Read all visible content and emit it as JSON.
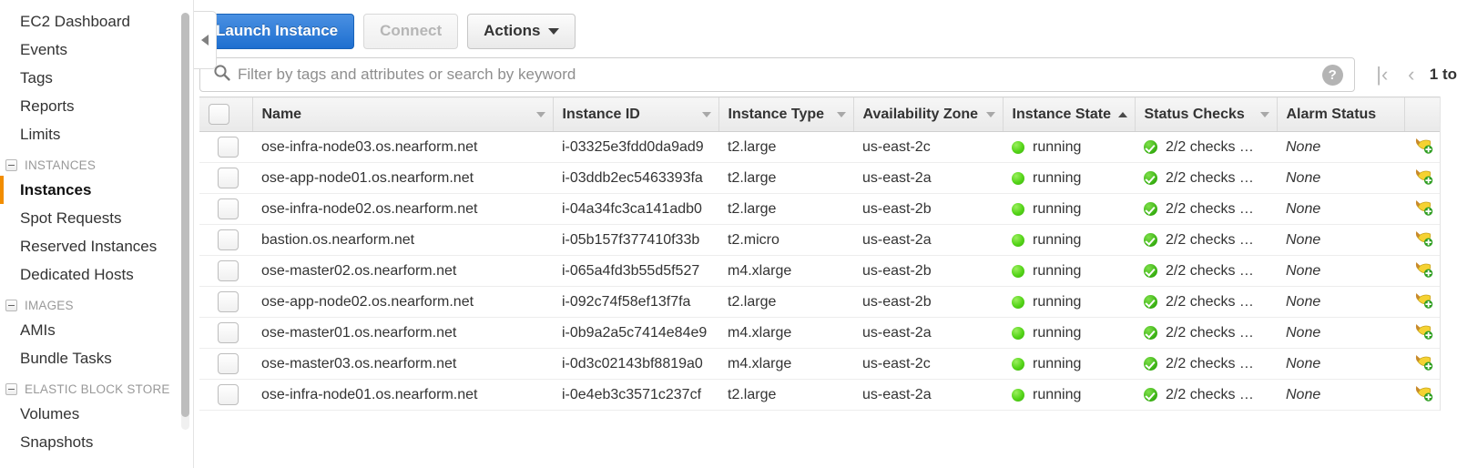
{
  "sidebar": {
    "top_links": [
      {
        "label": "EC2 Dashboard"
      },
      {
        "label": "Events"
      },
      {
        "label": "Tags"
      },
      {
        "label": "Reports"
      },
      {
        "label": "Limits"
      }
    ],
    "groups": [
      {
        "title": "INSTANCES",
        "items": [
          {
            "label": "Instances",
            "selected": true
          },
          {
            "label": "Spot Requests",
            "selected": false
          },
          {
            "label": "Reserved Instances",
            "selected": false
          },
          {
            "label": "Dedicated Hosts",
            "selected": false
          }
        ]
      },
      {
        "title": "IMAGES",
        "items": [
          {
            "label": "AMIs",
            "selected": false
          },
          {
            "label": "Bundle Tasks",
            "selected": false
          }
        ]
      },
      {
        "title": "ELASTIC BLOCK STORE",
        "items": [
          {
            "label": "Volumes",
            "selected": false
          },
          {
            "label": "Snapshots",
            "selected": false
          }
        ]
      }
    ],
    "collapse_icon": "collapse-left-icon"
  },
  "toolbar": {
    "launch_label": "Launch Instance",
    "connect_label": "Connect",
    "actions_label": "Actions",
    "actions_caret_icon": "chevron-down-icon"
  },
  "search": {
    "placeholder": "Filter by tags and attributes or search by keyword",
    "value": "",
    "search_icon": "search-icon",
    "help_icon": "help-icon",
    "help_label": "?"
  },
  "pagination": {
    "first_icon": "first-page-icon",
    "first_label": "|‹",
    "prev_icon": "previous-page-icon",
    "prev_label": "‹",
    "range_text": "1 to"
  },
  "table": {
    "columns": [
      {
        "label": "",
        "sort": "none",
        "key": "check"
      },
      {
        "label": "Name",
        "sort": "desc",
        "key": "name"
      },
      {
        "label": "Instance ID",
        "sort": "desc",
        "key": "id"
      },
      {
        "label": "Instance Type",
        "sort": "desc",
        "key": "type"
      },
      {
        "label": "Availability Zone",
        "sort": "desc",
        "key": "az"
      },
      {
        "label": "Instance State",
        "sort": "asc",
        "key": "state"
      },
      {
        "label": "Status Checks",
        "sort": "desc",
        "key": "checks"
      },
      {
        "label": "Alarm Status",
        "sort": "none",
        "key": "alarm"
      },
      {
        "label": "",
        "sort": "none",
        "key": "action"
      }
    ],
    "rows": [
      {
        "name": "ose-infra-node03.os.nearform.net",
        "id": "i-03325e3fdd0da9ad9",
        "type": "t2.large",
        "az": "us-east-2c",
        "state": "running",
        "checks": "2/2 checks …",
        "alarm": "None",
        "alarm_icon": "create-alarm-icon"
      },
      {
        "name": "ose-app-node01.os.nearform.net",
        "id": "i-03ddb2ec5463393fa",
        "type": "t2.large",
        "az": "us-east-2a",
        "state": "running",
        "checks": "2/2 checks …",
        "alarm": "None",
        "alarm_icon": "create-alarm-icon"
      },
      {
        "name": "ose-infra-node02.os.nearform.net",
        "id": "i-04a34fc3ca141adb0",
        "type": "t2.large",
        "az": "us-east-2b",
        "state": "running",
        "checks": "2/2 checks …",
        "alarm": "None",
        "alarm_icon": "create-alarm-icon"
      },
      {
        "name": "bastion.os.nearform.net",
        "id": "i-05b157f377410f33b",
        "type": "t2.micro",
        "az": "us-east-2a",
        "state": "running",
        "checks": "2/2 checks …",
        "alarm": "None",
        "alarm_icon": "create-alarm-icon"
      },
      {
        "name": "ose-master02.os.nearform.net",
        "id": "i-065a4fd3b55d5f527",
        "type": "m4.xlarge",
        "az": "us-east-2b",
        "state": "running",
        "checks": "2/2 checks …",
        "alarm": "None",
        "alarm_icon": "create-alarm-icon"
      },
      {
        "name": "ose-app-node02.os.nearform.net",
        "id": "i-092c74f58ef13f7fa",
        "type": "t2.large",
        "az": "us-east-2b",
        "state": "running",
        "checks": "2/2 checks …",
        "alarm": "None",
        "alarm_icon": "create-alarm-icon"
      },
      {
        "name": "ose-master01.os.nearform.net",
        "id": "i-0b9a2a5c7414e84e9",
        "type": "m4.xlarge",
        "az": "us-east-2a",
        "state": "running",
        "checks": "2/2 checks …",
        "alarm": "None",
        "alarm_icon": "create-alarm-icon"
      },
      {
        "name": "ose-master03.os.nearform.net",
        "id": "i-0d3c02143bf8819a0",
        "type": "m4.xlarge",
        "az": "us-east-2c",
        "state": "running",
        "checks": "2/2 checks …",
        "alarm": "None",
        "alarm_icon": "create-alarm-icon"
      },
      {
        "name": "ose-infra-node01.os.nearform.net",
        "id": "i-0e4eb3c3571c237cf",
        "type": "t2.large",
        "az": "us-east-2a",
        "state": "running",
        "checks": "2/2 checks …",
        "alarm": "None",
        "alarm_icon": "create-alarm-icon"
      }
    ]
  },
  "colors": {
    "primary_button": "#1e6fd0",
    "selected_accent": "#f28d00",
    "running_green": "#53d417",
    "check_green": "#36ae10"
  }
}
